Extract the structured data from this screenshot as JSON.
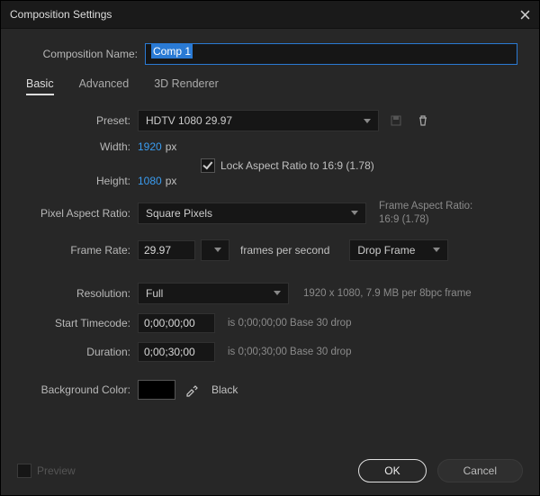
{
  "window": {
    "title": "Composition Settings"
  },
  "fields": {
    "comp_name_label": "Composition Name:",
    "comp_name_value": "Comp 1"
  },
  "tabs": {
    "basic": "Basic",
    "advanced": "Advanced",
    "renderer": "3D Renderer",
    "active": "basic"
  },
  "preset": {
    "label": "Preset:",
    "value": "HDTV 1080 29.97"
  },
  "width": {
    "label": "Width:",
    "value": "1920",
    "unit": "px"
  },
  "height": {
    "label": "Height:",
    "value": "1080",
    "unit": "px"
  },
  "lock": {
    "checked": true,
    "label": "Lock Aspect Ratio to 16:9 (1.78)"
  },
  "par": {
    "label": "Pixel Aspect Ratio:",
    "value": "Square Pixels",
    "frame_ratio_label": "Frame Aspect Ratio:",
    "frame_ratio_value": "16:9 (1.78)"
  },
  "fps": {
    "label": "Frame Rate:",
    "value": "29.97",
    "suffix": "frames per second",
    "drop": "Drop Frame"
  },
  "resolution": {
    "label": "Resolution:",
    "value": "Full",
    "hint": "1920 x 1080, 7.9 MB per 8bpc frame"
  },
  "start": {
    "label": "Start Timecode:",
    "value": "0;00;00;00",
    "hint": "is 0;00;00;00  Base 30  drop"
  },
  "duration": {
    "label": "Duration:",
    "value": "0;00;30;00",
    "hint": "is 0;00;30;00  Base 30  drop"
  },
  "bg": {
    "label": "Background Color:",
    "color": "#000000",
    "name": "Black"
  },
  "footer": {
    "preview": "Preview",
    "ok": "OK",
    "cancel": "Cancel"
  }
}
